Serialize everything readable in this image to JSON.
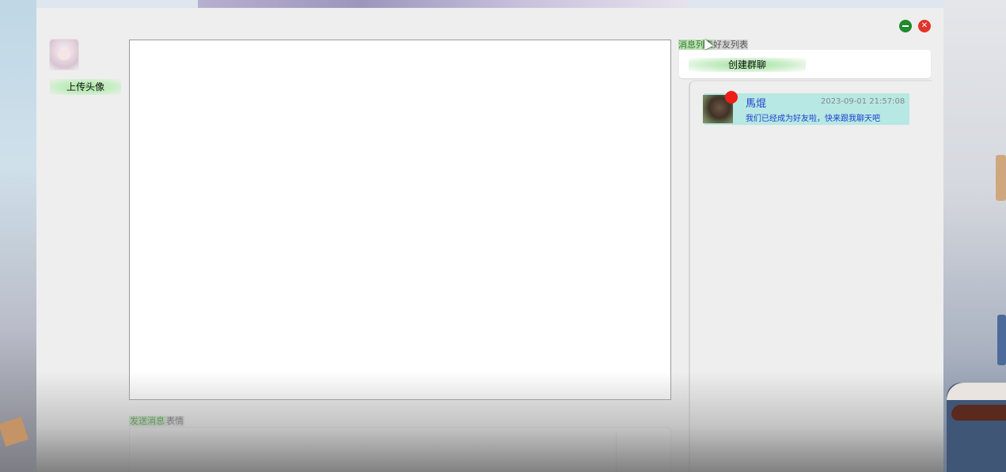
{
  "window": {
    "controls": {
      "minimize_icon": "minus-icon",
      "close_icon": "close-icon",
      "close_glyph": "✕"
    }
  },
  "profile": {
    "avatar_icon": "user-avatar-image",
    "upload_label": "上传头像"
  },
  "composer": {
    "tabs": [
      {
        "label": "发送消息"
      },
      {
        "label": "表情"
      }
    ],
    "input_value": ""
  },
  "sidebar": {
    "tabs": [
      {
        "label": "消息列表"
      },
      {
        "label": "好友列表"
      }
    ],
    "create_group_label": "创建群聊",
    "messages": [
      {
        "name": "馬焜",
        "time": "2023-09-01 21:57:08",
        "preview": "我们已经成为好友啦，快来跟我聊天吧",
        "unread": true
      }
    ]
  },
  "colors": {
    "minimize": "#1f8a2e",
    "close": "#e0352b",
    "message_item_bg": "#b7e8e3",
    "unread_badge": "#ef1c18",
    "name_text": "#1d3fd0"
  }
}
